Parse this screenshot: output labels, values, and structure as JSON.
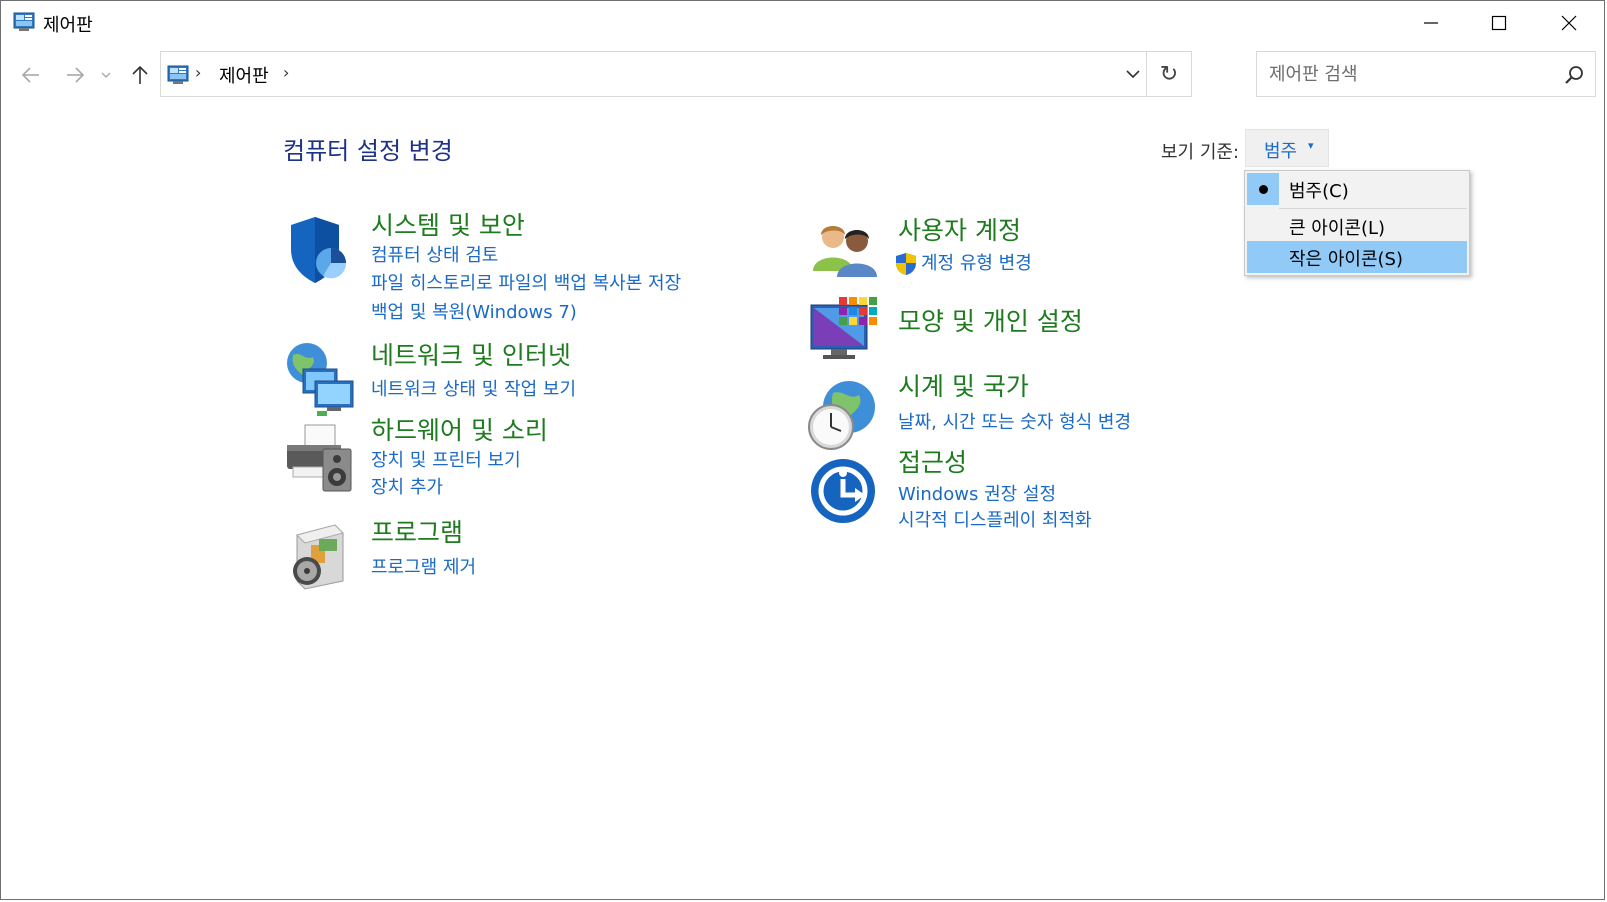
{
  "window": {
    "title": "제어판"
  },
  "nav": {
    "breadcrumb": "제어판",
    "separator": "›",
    "search_placeholder": "제어판 검색",
    "refresh_glyph": "↻"
  },
  "content": {
    "title": "컴퓨터 설정 변경",
    "view_by_label": "보기 기준:",
    "view_by_value": "범주",
    "view_by_arrow": "▾"
  },
  "view_menu": {
    "items": [
      {
        "label": "범주(C)",
        "selected": true
      },
      {
        "label": "큰 아이콘(L)",
        "selected": false
      },
      {
        "label": "작은 아이콘(S)",
        "selected": false,
        "highlighted": true
      }
    ]
  },
  "categories": {
    "system": {
      "title": "시스템 및 보안",
      "icon": "shield-icon",
      "links": [
        "컴퓨터 상태 검토",
        "파일 히스토리로 파일의 백업 복사본 저장",
        "백업 및 복원(Windows 7)"
      ]
    },
    "network": {
      "title": "네트워크 및 인터넷",
      "icon": "network-globe-icon",
      "links": [
        "네트워크 상태 및 작업 보기"
      ]
    },
    "hardware": {
      "title": "하드웨어 및 소리",
      "icon": "printer-speaker-icon",
      "links": [
        "장치 및 프린터 보기",
        "장치 추가"
      ]
    },
    "programs": {
      "title": "프로그램",
      "icon": "program-disc-icon",
      "links": [
        "프로그램 제거"
      ]
    },
    "users": {
      "title": "사용자 계정",
      "icon": "users-icon",
      "links": [
        "계정 유형 변경"
      ]
    },
    "appearance": {
      "title": "모양 및 개인 설정",
      "icon": "monitor-palette-icon",
      "links": []
    },
    "clock": {
      "title": "시계 및 국가",
      "icon": "clock-globe-icon",
      "links": [
        "날짜, 시간 또는 숫자 형식 변경"
      ]
    },
    "access": {
      "title": "접근성",
      "icon": "accessibility-icon",
      "links": [
        "Windows 권장 설정",
        "시각적 디스플레이 최적화"
      ]
    }
  },
  "colors": {
    "title_blue": "#1e3287",
    "category_green": "#1e7b1e",
    "link_blue": "#1a6ac6",
    "menu_highlight": "#91c9f7"
  }
}
